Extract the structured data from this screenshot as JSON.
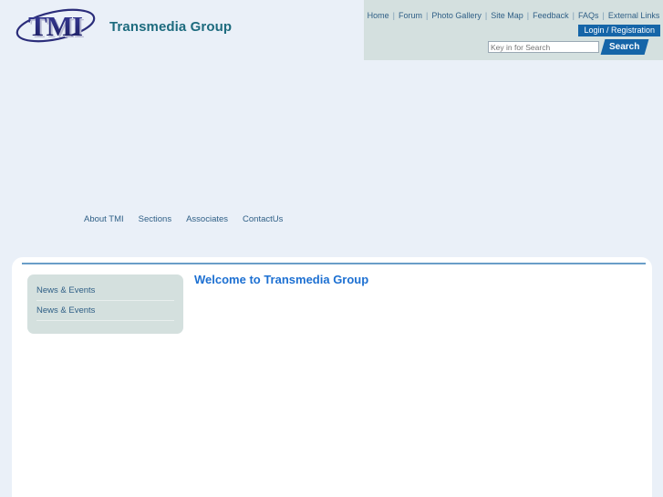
{
  "brand": {
    "logo_text": "TMI",
    "name": "Transmedia Group",
    "logo_color": "#2b2d7a",
    "name_color": "#1d6b7e"
  },
  "topnav": {
    "links": [
      "Home",
      "Forum",
      "Photo Gallery",
      "Site Map",
      "Feedback",
      "FAQs",
      "External Links"
    ],
    "separator": "|",
    "login_label": "Login / Registration",
    "login_bg": "#1565a8",
    "panel_bg": "#d4e0df"
  },
  "search": {
    "placeholder": "Key in for Search",
    "value": "",
    "button_label": "Search",
    "button_bg": "#1565a8"
  },
  "mainnav": {
    "items": [
      "About TMI",
      "Sections",
      "Associates",
      "ContactUs"
    ],
    "link_color": "#2f5f86"
  },
  "sidebar": {
    "box_bg": "#d4e0de",
    "items": [
      {
        "label": "News & Events"
      },
      {
        "label": "News & Events"
      }
    ]
  },
  "main": {
    "welcome_title": "Welcome to Transmedia Group",
    "title_color": "#1d70d2",
    "rule_color": "#6a9ec8"
  },
  "page": {
    "background": "#eaf0f8",
    "panel_background": "#ffffff"
  }
}
